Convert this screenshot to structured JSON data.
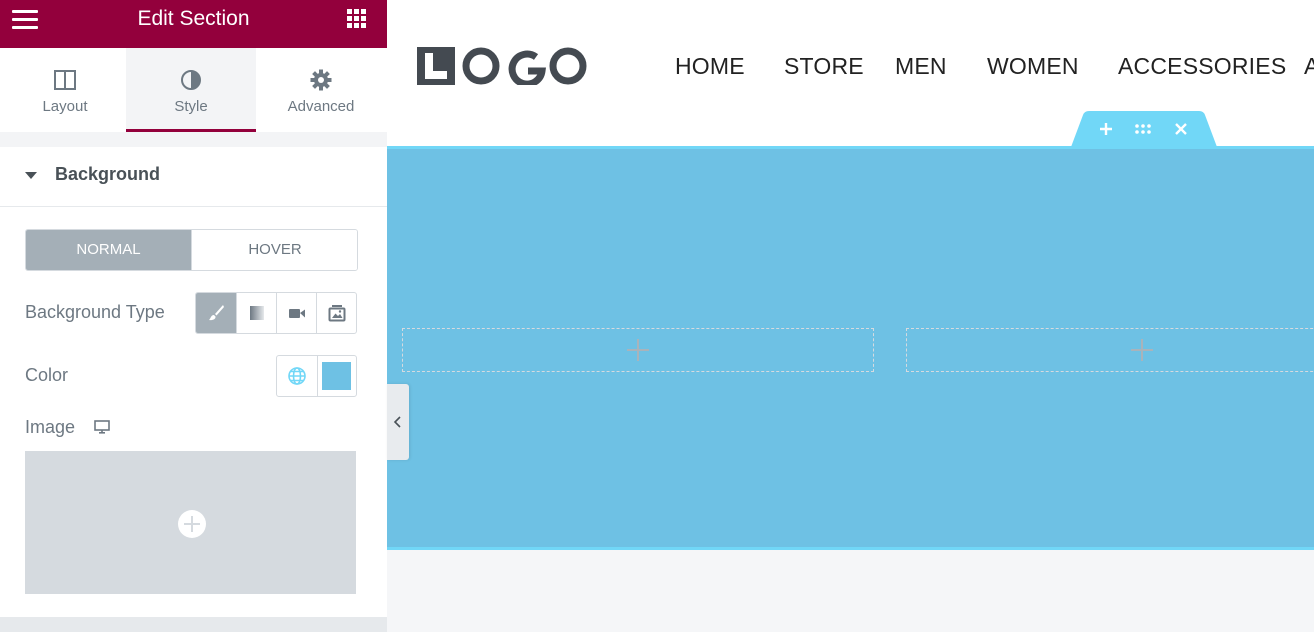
{
  "panel": {
    "title": "Edit Section",
    "brand_color": "#93003c",
    "tabs": [
      {
        "label": "Layout",
        "icon": "columns-icon"
      },
      {
        "label": "Style",
        "icon": "contrast-icon",
        "active": true
      },
      {
        "label": "Advanced",
        "icon": "gear-icon"
      }
    ]
  },
  "background": {
    "section_title": "Background",
    "state_tabs": {
      "normal": "NORMAL",
      "hover": "HOVER",
      "selected": "NORMAL"
    },
    "type_label": "Background Type",
    "type_options": [
      "classic-brush-icon",
      "gradient-icon",
      "video-icon",
      "slideshow-icon"
    ],
    "type_selected": "classic-brush-icon",
    "color_label": "Color",
    "color_value": "#6ec1e4",
    "image_label": "Image"
  },
  "preview": {
    "logo_text": "LOGO",
    "nav": [
      "HOME",
      "STORE",
      "MEN",
      "WOMEN",
      "ACCESSORIES",
      "A"
    ],
    "section_color": "#6ec1e4",
    "handle_color": "#71d7f7",
    "columns": 2
  }
}
